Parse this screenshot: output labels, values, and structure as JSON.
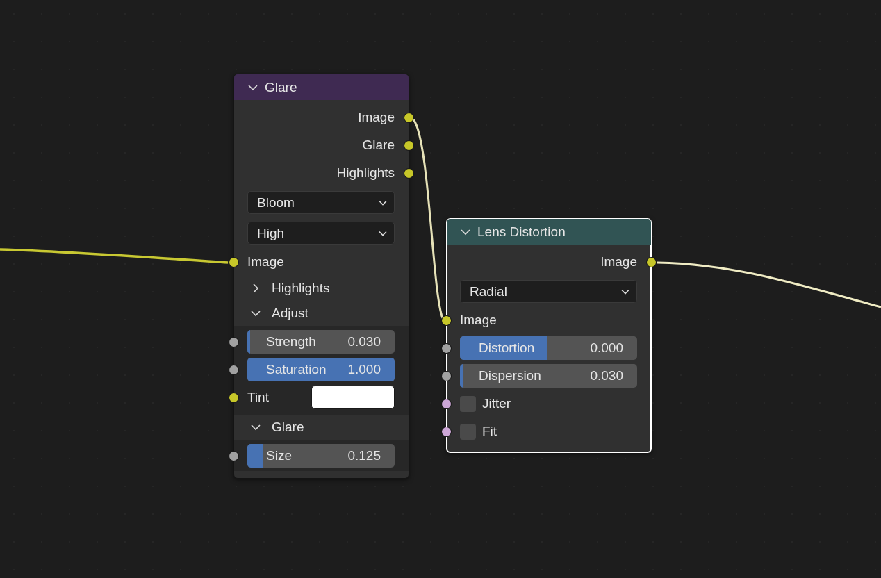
{
  "nodes": [
    {
      "title": "Glare",
      "color": "#3f2a52",
      "selected": false,
      "expanded": true,
      "rows": [
        {
          "kind": "output",
          "label": "Image",
          "socket": {
            "color": "#c7c729"
          }
        },
        {
          "kind": "output",
          "label": "Glare",
          "socket": {
            "color": "#c7c729"
          }
        },
        {
          "kind": "output",
          "label": "Highlights",
          "socket": {
            "color": "#c7c729"
          }
        },
        {
          "kind": "dropdown",
          "value": "Bloom"
        },
        {
          "kind": "dropdown",
          "value": "High"
        },
        {
          "kind": "input",
          "label": "Image",
          "socket": {
            "color": "#c7c729"
          }
        },
        {
          "kind": "panel",
          "label": "Highlights",
          "expanded": false
        },
        {
          "kind": "panel",
          "label": "Adjust",
          "expanded": true,
          "children": [
            {
              "kind": "slider",
              "label": "Strength",
              "value": "0.030",
              "level": 0.02,
              "socket": {
                "color": "#a1a1a1"
              }
            },
            {
              "kind": "slider",
              "label": "Saturation",
              "value": "1.000",
              "level": 1,
              "socket": {
                "color": "#a1a1a1"
              }
            },
            {
              "kind": "color",
              "label": "Tint",
              "color": "#ffffff",
              "socket": {
                "color": "#c7c729"
              }
            }
          ]
        },
        {
          "kind": "panel",
          "label": "Glare",
          "expanded": true,
          "children": [
            {
              "kind": "slider",
              "label": "Size",
              "value": "0.125",
              "level": 0.11,
              "socket": {
                "color": "#a1a1a1"
              }
            }
          ]
        }
      ]
    },
    {
      "title": "Lens Distortion",
      "color": "#315454",
      "selected": true,
      "expanded": true,
      "rows": [
        {
          "kind": "output",
          "label": "Image",
          "socket": {
            "color": "#c7c729"
          }
        },
        {
          "kind": "dropdown",
          "value": "Radial"
        },
        {
          "kind": "input",
          "label": "Image",
          "socket": {
            "color": "#c7c729"
          }
        },
        {
          "kind": "slider",
          "label": "Distortion",
          "value": "0.000",
          "level": 0.49,
          "socket": {
            "color": "#a1a1a1"
          }
        },
        {
          "kind": "slider",
          "label": "Dispersion",
          "value": "0.030",
          "level": 0.02,
          "socket": {
            "color": "#a1a1a1"
          }
        },
        {
          "kind": "checkbox",
          "label": "Jitter",
          "checked": false,
          "socket": {
            "color": "#cca6d6"
          }
        },
        {
          "kind": "checkbox",
          "label": "Fit",
          "checked": false,
          "socket": {
            "color": "#cca6d6"
          }
        }
      ]
    }
  ]
}
